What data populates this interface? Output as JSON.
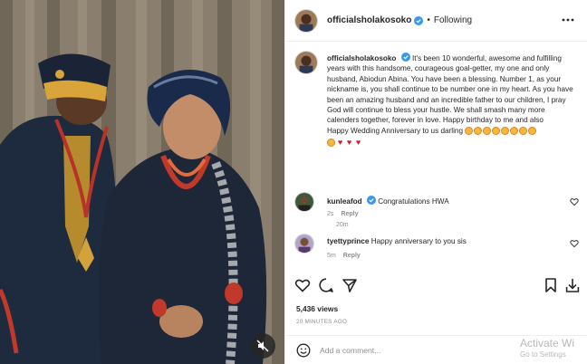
{
  "post": {
    "username": "officialsholakosoko",
    "separator": "•",
    "follow_status": "Following",
    "caption_text": "It's been 10 wonderful, awesome and fulfilling years with this handsome, courageous goal-getter, my one and only husband, Abiodun Abina. You have been a blessing. Number 1, as your nickname is, you shall continue to be number one in my heart. As you have been an amazing husband and an incredible father to our children, I pray God will continue to bless your hustle. We shall smash many more calenders together, forever in love. Happy birthday to me and also",
    "caption_last_line": "Happy Wedding Anniversary to us darling",
    "caption_time": "20m",
    "views": "5,436 views",
    "posted_ago": "20 MINUTES AGO"
  },
  "comments": [
    {
      "username": "kunleafod",
      "text": "Congratulations HWA",
      "time": "2s",
      "reply_label": "Reply"
    },
    {
      "username": "tyettyprince",
      "text": "Happy anniversary to you sis",
      "time": "5m",
      "reply_label": "Reply"
    }
  ],
  "add_comment": {
    "placeholder": "Add a comment..."
  },
  "watermark": {
    "line1": "Activate Wi",
    "line2": "Go to Settings"
  },
  "icons": {
    "more": "more-options-icon",
    "verified": "verified-badge-icon",
    "like": "heart-icon",
    "comment": "comment-icon",
    "share": "share-icon",
    "save": "bookmark-icon",
    "download": "download-icon",
    "emoji": "emoji-icon",
    "mute": "muted-speaker-icon"
  },
  "colors": {
    "verified": "#3897f0",
    "heart": "#d91b2a",
    "muted_text": "#8e8e8e"
  }
}
